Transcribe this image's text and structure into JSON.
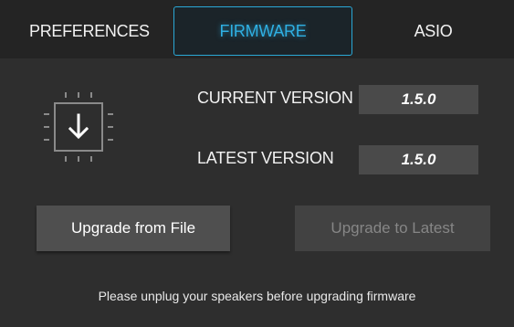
{
  "tabs": [
    {
      "label": "PREFERENCES",
      "active": false
    },
    {
      "label": "FIRMWARE",
      "active": true
    },
    {
      "label": "ASIO",
      "active": false
    }
  ],
  "firmware": {
    "icon": "chip-download-icon",
    "current_version_label": "CURRENT VERSION",
    "current_version_value": "1.5.0",
    "latest_version_label": "LATEST VERSION",
    "latest_version_value": "1.5.0"
  },
  "buttons": {
    "upgrade_from_file": "Upgrade from File",
    "upgrade_to_latest": "Upgrade to Latest",
    "upgrade_to_latest_enabled": false
  },
  "footer": {
    "note": "Please unplug your speakers before upgrading firmware"
  },
  "colors": {
    "background": "#2e2e2e",
    "tabbar": "#242424",
    "active_tab_accent": "#2fb0e3",
    "button": "#4f4f4f",
    "button_disabled": "#424242",
    "version_box": "#4a4a4a"
  }
}
